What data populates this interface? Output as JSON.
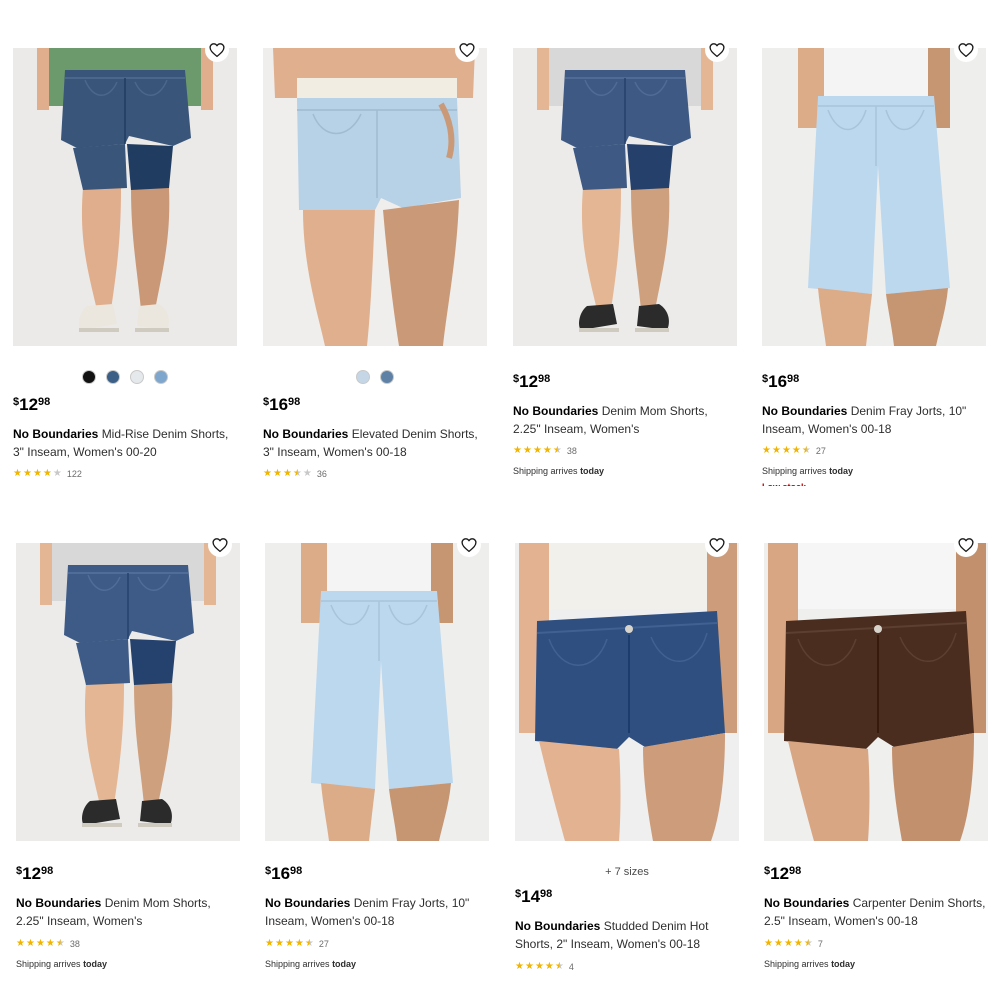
{
  "products": [
    {
      "brand": "No Boundaries",
      "name": "Mid-Rise Denim Shorts, 3\" Inseam, Women's 00-20",
      "price": {
        "symbol": "$",
        "dollars": "12",
        "cents": "98"
      },
      "rating": 4,
      "review_count": "122",
      "swatches": [
        "#121212",
        "#3b5f86",
        "#e6e9ec",
        "#7fa6cc"
      ],
      "image": {
        "top": "#6d9a6c",
        "shorts": "#39557a",
        "skin": "#e0ae8c",
        "shoes": "#ebe7df"
      }
    },
    {
      "brand": "No Boundaries",
      "name": "Elevated Denim Shorts, 3\" Inseam, Women's 00-18",
      "price": {
        "symbol": "$",
        "dollars": "16",
        "cents": "98"
      },
      "rating": 3.5,
      "review_count": "36",
      "swatches": [
        "#c5d6e7",
        "#5f81a6"
      ],
      "image": {
        "top": "#f1ede2",
        "shorts": "#b7d1e6",
        "skin": "#e0b08e"
      }
    },
    {
      "brand": "No Boundaries",
      "name": "Denim Mom Shorts, 2.25\" Inseam, Women's",
      "price": {
        "symbol": "$",
        "dollars": "12",
        "cents": "98"
      },
      "rating": 4.5,
      "review_count": "38",
      "shipping": {
        "prefix": "Shipping arrives",
        "when": "today"
      },
      "image": {
        "top": "#d8d8d8",
        "shorts": "#3e5a84",
        "skin": "#e4b694",
        "shoes": "#2b2b2b"
      }
    },
    {
      "brand": "No Boundaries",
      "name": "Denim Fray Jorts, 10\" Inseam, Women's 00-18",
      "price": {
        "symbol": "$",
        "dollars": "16",
        "cents": "98"
      },
      "rating": 4.5,
      "review_count": "27",
      "shipping": {
        "prefix": "Shipping arrives",
        "when": "today"
      },
      "low_stock": "Low stock",
      "image": {
        "top": "#f4f4f4",
        "shorts": "#bcd8ee",
        "skin": "#dcab88"
      }
    },
    {
      "brand": "No Boundaries",
      "name": "Denim Mom Shorts, 2.25\" Inseam, Women's",
      "price": {
        "symbol": "$",
        "dollars": "12",
        "cents": "98"
      },
      "rating": 4.5,
      "review_count": "38",
      "shipping": {
        "prefix": "Shipping arrives",
        "when": "today"
      },
      "image": {
        "top": "#d8d8d8",
        "shorts": "#3d5b86",
        "skin": "#e4b694",
        "shoes": "#2b2b2b"
      }
    },
    {
      "brand": "No Boundaries",
      "name": "Denim Fray Jorts, 10\" Inseam, Women's 00-18",
      "price": {
        "symbol": "$",
        "dollars": "16",
        "cents": "98"
      },
      "rating": 4.5,
      "review_count": "27",
      "shipping": {
        "prefix": "Shipping arrives",
        "when": "today"
      },
      "image": {
        "top": "#f4f4f4",
        "shorts": "#bcd8ee",
        "skin": "#dcab88"
      }
    },
    {
      "brand": "No Boundaries",
      "name": "Studded Denim Hot Shorts, 2\" Inseam, Women's 00-18",
      "price": {
        "symbol": "$",
        "dollars": "14",
        "cents": "98"
      },
      "rating": 4.5,
      "review_count": "4",
      "sizes_more": "+ 7 sizes",
      "image": {
        "top": "#f2f0ea",
        "shorts": "#2f4f80",
        "skin": "#e2b291"
      }
    },
    {
      "brand": "No Boundaries",
      "name": "Carpenter Denim Shorts, 2.5\" Inseam, Women's 00-18",
      "price": {
        "symbol": "$",
        "dollars": "12",
        "cents": "98"
      },
      "rating": 4.5,
      "review_count": "7",
      "shipping": {
        "prefix": "Shipping arrives",
        "when": "today"
      },
      "image": {
        "top": "#f6f6f6",
        "shorts": "#4a2d1f",
        "skin": "#d9a683"
      }
    }
  ]
}
